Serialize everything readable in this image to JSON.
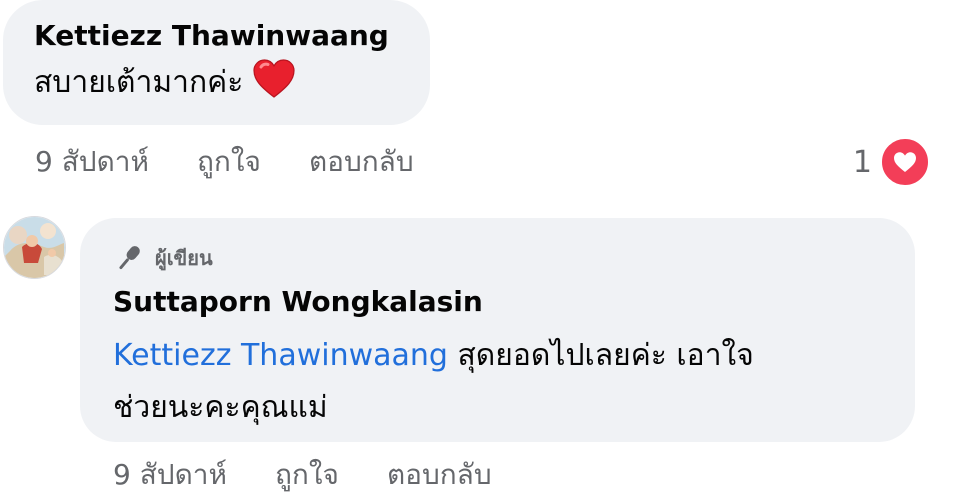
{
  "comment": {
    "author": "Kettiezz Thawinwaang",
    "text": "สบายเต้ามากค่ะ",
    "emoji": "red-heart",
    "time": "9 สัปดาห์",
    "like_label": "ถูกใจ",
    "reply_label": "ตอบกลับ",
    "reaction_count": "1",
    "reaction_type": "love",
    "reaction_color": "#f33e58"
  },
  "reply": {
    "badge": "ผู้เขียน",
    "author": "Suttaporn Wongkalasin",
    "mention": "Kettiezz Thawinwaang",
    "text_line1_rest": " สุดยอดไปเลยค่ะ เอาใจ",
    "text_line2": "ช่วยนะคะคุณแม่",
    "time": "9 สัปดาห์",
    "like_label": "ถูกใจ",
    "reply_label": "ตอบกลับ",
    "mention_color": "#216fdb"
  }
}
